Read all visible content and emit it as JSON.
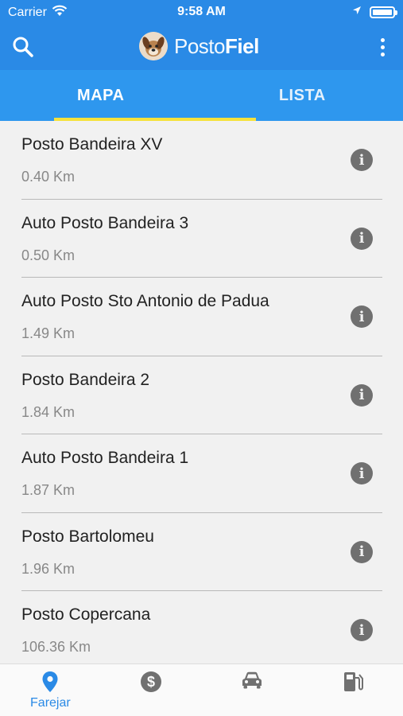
{
  "status_bar": {
    "carrier": "Carrier",
    "time": "9:58 AM"
  },
  "app_bar": {
    "brand_light": "Posto",
    "brand_bold": "Fiel"
  },
  "tabs": [
    {
      "label": "MAPA",
      "active": true
    },
    {
      "label": "LISTA",
      "active": false
    }
  ],
  "stations": [
    {
      "name": "Posto Bandeira XV",
      "distance": "0.40 Km"
    },
    {
      "name": "Auto Posto Bandeira 3",
      "distance": "0.50 Km"
    },
    {
      "name": "Auto Posto Sto Antonio de Padua",
      "distance": "1.49 Km"
    },
    {
      "name": "Posto Bandeira 2",
      "distance": "1.84 Km"
    },
    {
      "name": "Auto Posto Bandeira 1",
      "distance": "1.87 Km"
    },
    {
      "name": "Posto Bartolomeu",
      "distance": "1.96 Km"
    },
    {
      "name": "Posto Copercana",
      "distance": "106.36 Km"
    }
  ],
  "bottom_nav": [
    {
      "icon": "map-pin-icon",
      "label": "Farejar",
      "active": true
    },
    {
      "icon": "dollar-icon",
      "label": "",
      "active": false
    },
    {
      "icon": "car-icon",
      "label": "",
      "active": false
    },
    {
      "icon": "fuel-pump-icon",
      "label": "",
      "active": false
    }
  ],
  "colors": {
    "primary": "#2a8ae6",
    "tab_bar": "#2e97ee",
    "tab_indicator": "#f5e23c",
    "inactive_icon": "#707070"
  }
}
